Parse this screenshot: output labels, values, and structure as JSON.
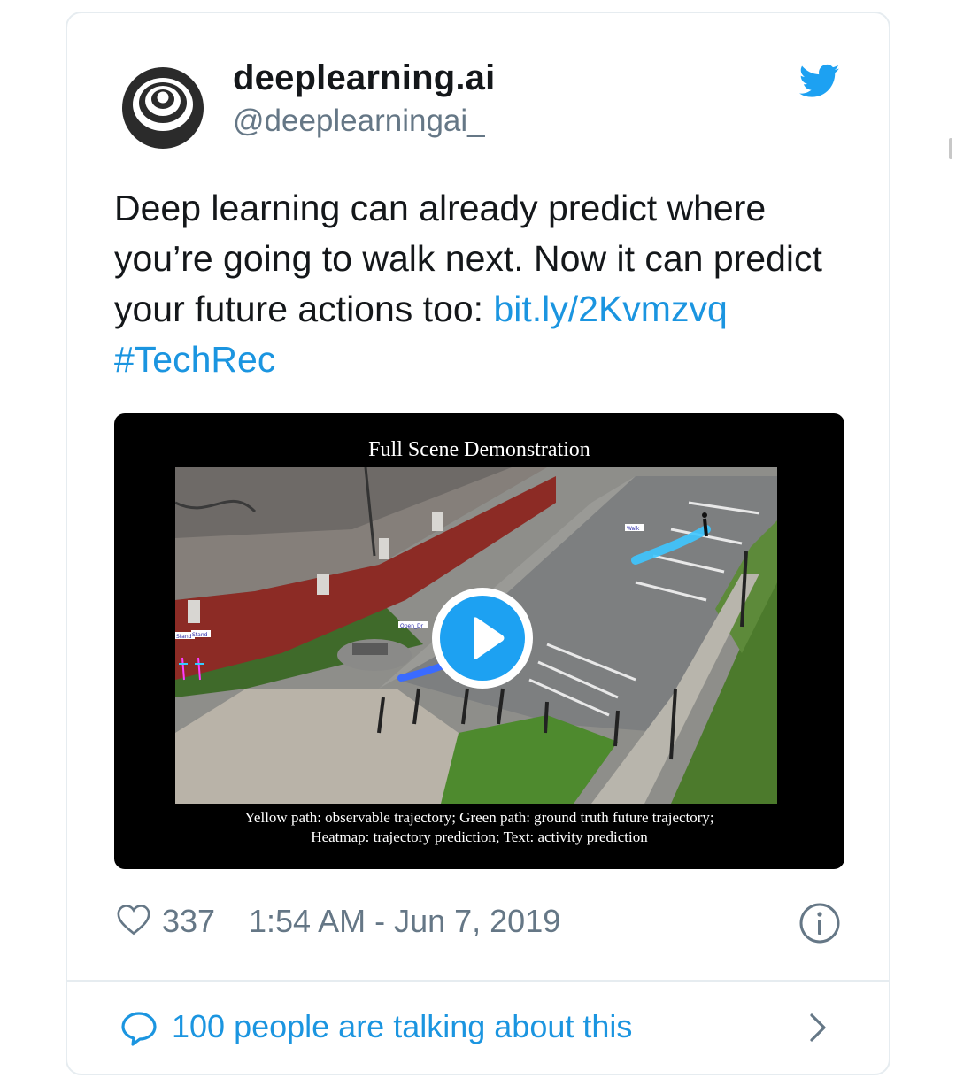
{
  "account": {
    "display_name": "deeplearning.ai",
    "handle": "@deeplearningai_"
  },
  "tweet": {
    "text": "Deep learning can already predict where you’re going to walk next. Now it can predict your future actions too: ",
    "link": "bit.ly/2Kvmzvq",
    "hashtag": "#TechRec"
  },
  "media": {
    "title": "Full Scene Demonstration",
    "caption_line1": "Yellow path: observable trajectory; Green path: ground truth future trajectory;",
    "caption_line2": "Heatmap: trajectory prediction; Text: activity prediction",
    "labels": {
      "walk": "Walk",
      "open_door": "Open_Dr",
      "stand1": "Stand",
      "stand2": "Stand"
    },
    "play_icon": "play-icon"
  },
  "meta": {
    "like_count": "337",
    "timestamp": "1:54 AM - Jun 7, 2019",
    "icons": [
      "heart-icon",
      "info-icon"
    ]
  },
  "footer": {
    "talk_text": "100 people are talking about this",
    "icons": [
      "speech-bubble-icon",
      "chevron-right-icon"
    ]
  },
  "colors": {
    "link": "#1b95e0",
    "twitter_blue": "#1da1f2",
    "text": "#14171a",
    "secondary": "#657786",
    "border": "#e6ecf0"
  }
}
